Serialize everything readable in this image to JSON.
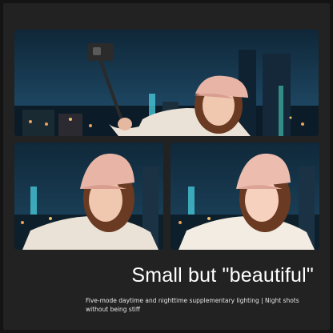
{
  "headline": "Small but \"beautiful\"",
  "subtitle": "Five-mode daytime and nighttime supplementary lighting | Night shots without being stiff",
  "colors": {
    "background": "#222222",
    "sky": "#1b3a4e",
    "cap": "#e8b4a6",
    "jacket": "#eae2d6",
    "hair": "#6b3a22",
    "accent_light": "#46c6d6"
  }
}
